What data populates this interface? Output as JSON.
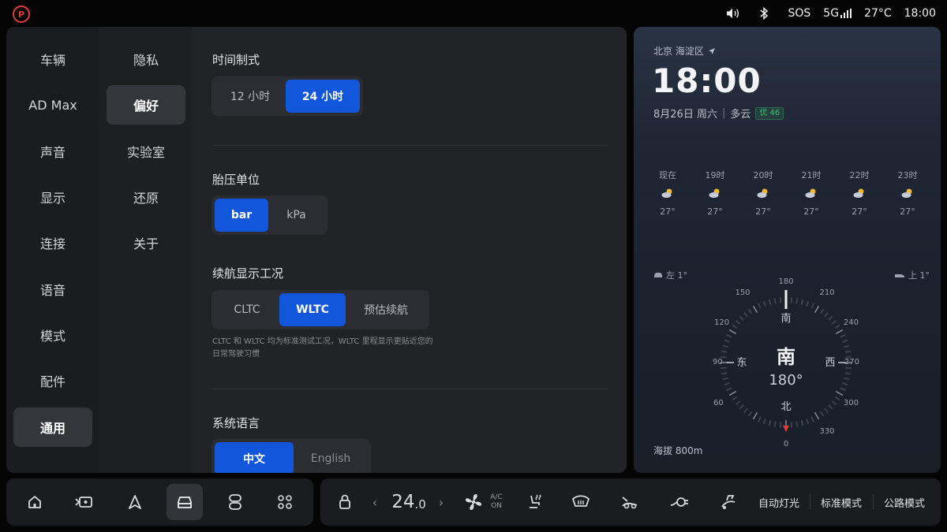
{
  "status": {
    "sos": "SOS",
    "network": "5G",
    "temperature": "27°C",
    "time": "18:00"
  },
  "sidebar": {
    "items": [
      {
        "label": "车辆"
      },
      {
        "label": "AD Max"
      },
      {
        "label": "声音"
      },
      {
        "label": "显示"
      },
      {
        "label": "连接"
      },
      {
        "label": "语音"
      },
      {
        "label": "模式"
      },
      {
        "label": "配件"
      },
      {
        "label": "通用",
        "selected": true
      }
    ]
  },
  "subnav": {
    "items": [
      {
        "label": "隐私"
      },
      {
        "label": "偏好",
        "selected": true
      },
      {
        "label": "实验室"
      },
      {
        "label": "还原"
      },
      {
        "label": "关于"
      }
    ]
  },
  "prefs": {
    "time_format": {
      "title": "时间制式",
      "options": [
        "12 小时",
        "24 小时"
      ],
      "selected": "24 小时"
    },
    "tire_unit": {
      "title": "胎压单位",
      "options": [
        "bar",
        "kPa"
      ],
      "selected": "bar"
    },
    "range_mode": {
      "title": "续航显示工况",
      "options": [
        "CLTC",
        "WLTC",
        "预估续航"
      ],
      "selected": "WLTC",
      "note": "CLTC 和 WLTC 均为标准测试工况，WLTC 里程显示更贴近您的日常驾驶习惯"
    },
    "language": {
      "title": "系统语言",
      "options": [
        "中文",
        "English"
      ],
      "selected": "中文"
    }
  },
  "weather": {
    "location": "北京 海淀区",
    "time": "18:00",
    "date": "8月26日 周六",
    "condition": "多云",
    "aqi": "优 46",
    "hourly": [
      {
        "label": "现在",
        "temp": "27°"
      },
      {
        "label": "19时",
        "temp": "27°"
      },
      {
        "label": "20时",
        "temp": "27°"
      },
      {
        "label": "21时",
        "temp": "27°"
      },
      {
        "label": "22时",
        "temp": "27°"
      },
      {
        "label": "23时",
        "temp": "27°"
      }
    ],
    "compass": {
      "heading": "南",
      "degrees": "180°",
      "left_slope": "左 1°",
      "up_slope": "上 1°",
      "cardinals": {
        "n": "北",
        "s": "南",
        "e": "东",
        "w": "西"
      },
      "scale": [
        "180",
        "210",
        "240",
        "270",
        "300",
        "330",
        "0",
        "60",
        "90",
        "120",
        "150"
      ]
    },
    "altitude": "海拔 800m"
  },
  "dock": {
    "items": [
      "home-icon",
      "camera-icon",
      "navigation-icon",
      "car-icon",
      "app-switch-icon",
      "apps-grid-icon"
    ],
    "selected": "car-icon"
  },
  "climate": {
    "temp_int": "24",
    "temp_dec": ".0",
    "ac_top": "A/C",
    "ac_bottom": "ON",
    "light_mode": "自动灯光",
    "drive_mode": "标准模式",
    "road_mode": "公路模式"
  },
  "colors": {
    "accent": "#1256db",
    "parking": "#e23b3b",
    "aqi": "#3bc46a"
  }
}
